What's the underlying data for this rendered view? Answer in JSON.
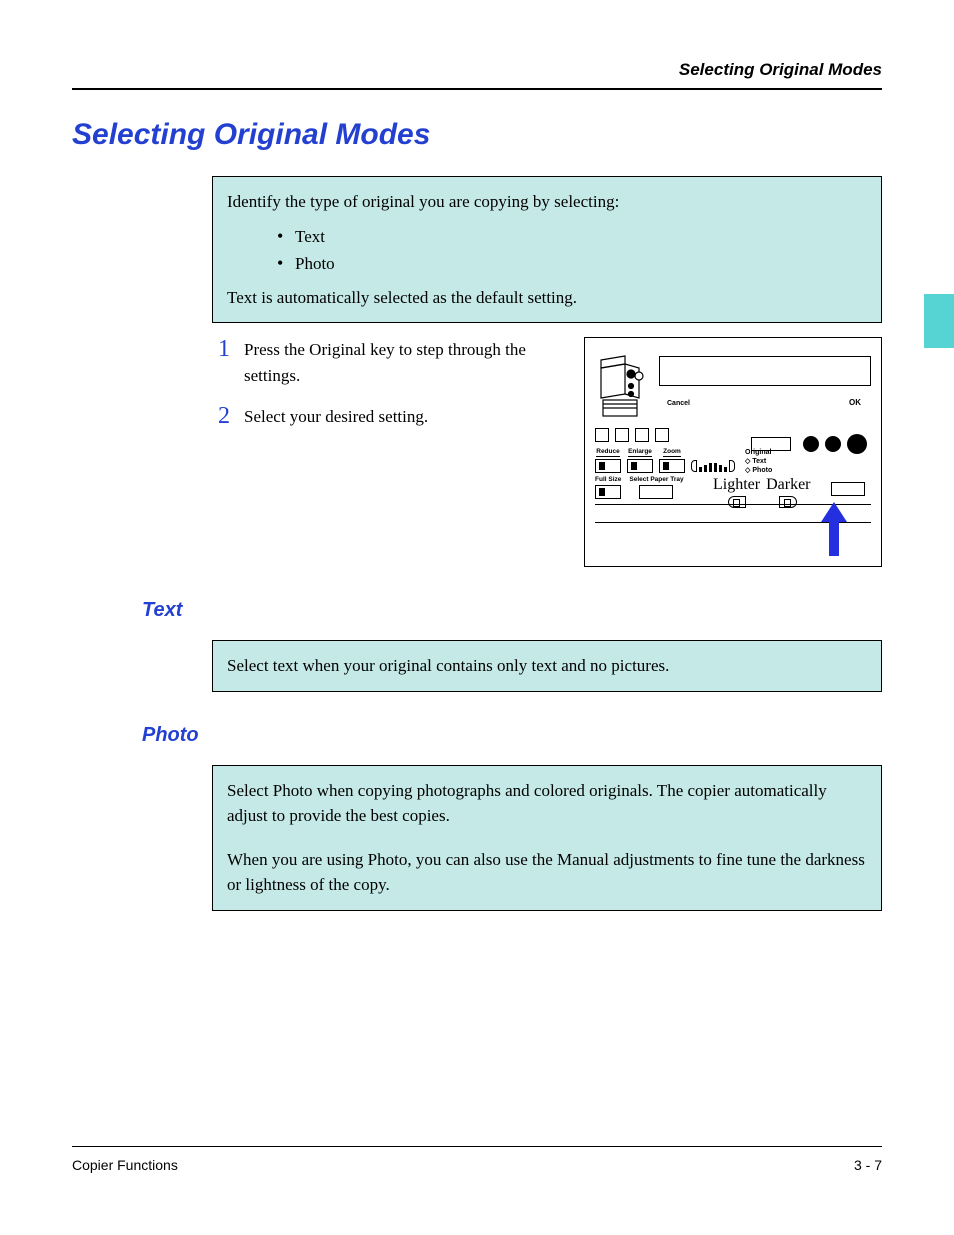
{
  "header": {
    "running_title": "Selecting Original Modes"
  },
  "title": "Selecting Original Modes",
  "intro": {
    "lead": "Identify the type of original you are copying by selecting:",
    "bullets": [
      "Text",
      "Photo"
    ],
    "default_note": "Text is automatically selected as the default setting."
  },
  "steps": [
    {
      "num": "1",
      "text": "Press the Original key to step through the settings."
    },
    {
      "num": "2",
      "text": "Select your desired setting."
    }
  ],
  "panel": {
    "cancel": "Cancel",
    "ok": "OK",
    "labels": {
      "reduce": "Reduce",
      "enlarge": "Enlarge",
      "zoom": "Zoom",
      "full_size": "Full Size",
      "select_paper_tray": "Select Paper Tray",
      "lighter": "Lighter",
      "darker": "Darker",
      "original": "Original",
      "text": "Text",
      "photo": "Photo"
    }
  },
  "sections": {
    "text": {
      "heading": "Text",
      "body": "Select text when your original contains only text and no pictures."
    },
    "photo": {
      "heading": "Photo",
      "p1": "Select Photo when copying photographs and colored originals. The copier automatically adjust to provide the best copies.",
      "p2": "When you are using Photo, you can also use the Manual adjustments to fine tune the darkness or lightness of the copy."
    }
  },
  "footer": {
    "left": "Copier Functions",
    "right": "3 - 7"
  }
}
